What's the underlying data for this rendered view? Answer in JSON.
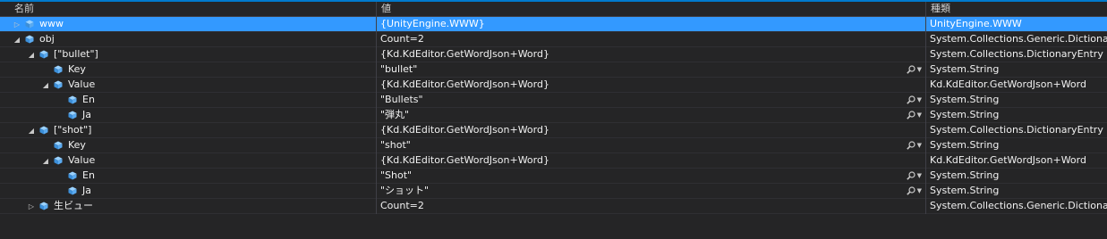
{
  "header": {
    "name": "名前",
    "value": "値",
    "type": "種類"
  },
  "rows": [
    {
      "name": "www",
      "value": "{UnityEngine.WWW}",
      "type": "UnityEngine.WWW",
      "selected": true,
      "expander": "collapsed",
      "indent": 0,
      "inspect": false
    },
    {
      "name": "obj",
      "value": "Count=2",
      "type": "System.Collections.Generic.Dictionary",
      "selected": false,
      "expander": "expanded",
      "indent": 0,
      "inspect": false
    },
    {
      "name": "[\"bullet\"]",
      "value": "{Kd.KdEditor.GetWordJson+Word}",
      "type": "System.Collections.DictionaryEntry",
      "selected": false,
      "expander": "expanded",
      "indent": 1,
      "inspect": false
    },
    {
      "name": "Key",
      "value": "\"bullet\"",
      "type": "System.String",
      "selected": false,
      "expander": "none",
      "indent": 2,
      "inspect": true
    },
    {
      "name": "Value",
      "value": "{Kd.KdEditor.GetWordJson+Word}",
      "type": "Kd.KdEditor.GetWordJson+Word",
      "selected": false,
      "expander": "expanded",
      "indent": 2,
      "inspect": false
    },
    {
      "name": "En",
      "value": "\"Bullets\"",
      "type": "System.String",
      "selected": false,
      "expander": "none",
      "indent": 3,
      "inspect": true
    },
    {
      "name": "Ja",
      "value": "\"弾丸\"",
      "type": "System.String",
      "selected": false,
      "expander": "none",
      "indent": 3,
      "inspect": true
    },
    {
      "name": "[\"shot\"]",
      "value": "{Kd.KdEditor.GetWordJson+Word}",
      "type": "System.Collections.DictionaryEntry",
      "selected": false,
      "expander": "expanded",
      "indent": 1,
      "inspect": false
    },
    {
      "name": "Key",
      "value": "\"shot\"",
      "type": "System.String",
      "selected": false,
      "expander": "none",
      "indent": 2,
      "inspect": true
    },
    {
      "name": "Value",
      "value": "{Kd.KdEditor.GetWordJson+Word}",
      "type": "Kd.KdEditor.GetWordJson+Word",
      "selected": false,
      "expander": "expanded",
      "indent": 2,
      "inspect": false
    },
    {
      "name": "En",
      "value": "\"Shot\"",
      "type": "System.String",
      "selected": false,
      "expander": "none",
      "indent": 3,
      "inspect": true
    },
    {
      "name": "Ja",
      "value": "\"ショット\"",
      "type": "System.String",
      "selected": false,
      "expander": "none",
      "indent": 3,
      "inspect": true
    },
    {
      "name": "生ビュー",
      "value": "Count=2",
      "type": "System.Collections.Generic.Dictionary",
      "selected": false,
      "expander": "collapsed",
      "indent": 1,
      "inspect": false
    }
  ],
  "icons": {
    "object": "object-cube-icon",
    "magnifier": "magnifier-icon",
    "dropdown": "dropdown-arrow-icon"
  },
  "colors": {
    "background": "#252526",
    "selection": "#3399ff",
    "accent": "#007acc",
    "icon": "#75beff"
  }
}
